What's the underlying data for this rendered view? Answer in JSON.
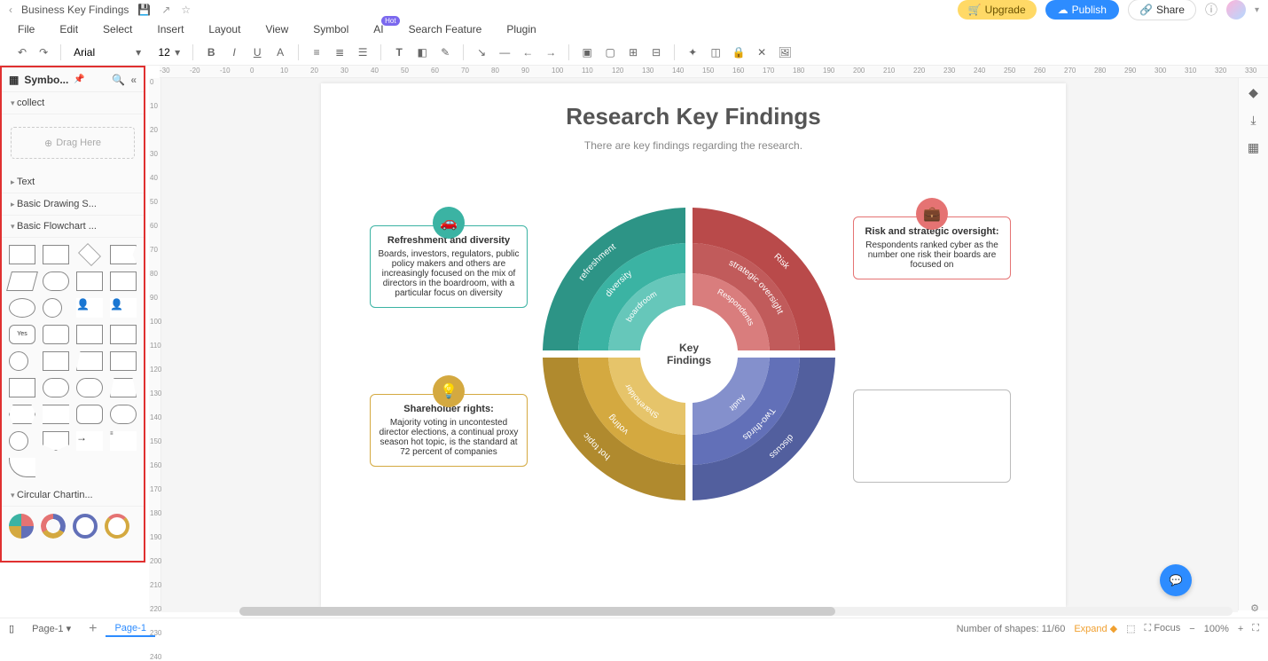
{
  "titlebar": {
    "doc_title": "Business Key Findings"
  },
  "buttons": {
    "upgrade": "Upgrade",
    "publish": "Publish",
    "share": "Share"
  },
  "menu": {
    "file": "File",
    "edit": "Edit",
    "select": "Select",
    "insert": "Insert",
    "layout": "Layout",
    "view": "View",
    "symbol": "Symbol",
    "ai": "AI",
    "search": "Search Feature",
    "plugin": "Plugin"
  },
  "toolbar": {
    "font": "Arial",
    "size": "12"
  },
  "sidebar": {
    "title": "Symbo...",
    "collect": "collect",
    "drag": "Drag Here",
    "text": "Text",
    "basic_drawing": "Basic Drawing S...",
    "basic_flowchart": "Basic Flowchart ...",
    "circular": "Circular Chartin..."
  },
  "canvas": {
    "title": "Research Key Findings",
    "subtitle": "There are key findings regarding the research.",
    "center": "Key Findings",
    "segments": {
      "q1": {
        "outer": "Risk",
        "mid": "strategic oversight",
        "inner": "Respondents"
      },
      "q2": {
        "outer": "discuss",
        "mid": "Two-thirds",
        "inner": "Audit"
      },
      "q3": {
        "outer": "hot topic",
        "mid": "voting",
        "inner": "Shareholder"
      },
      "q4": {
        "outer": "refreshment",
        "mid": "diversity",
        "inner": "boardroom"
      }
    },
    "callouts": {
      "teal": {
        "title": "Refreshment and diversity",
        "body": "Boards, investors, regulators, public policy makers and others are increasingly focused on the mix of directors in the boardroom, with a particular focus on diversity"
      },
      "red": {
        "title": "Risk and strategic oversight:",
        "body": "Respondents ranked cyber as the number one risk their boards are focused on"
      },
      "yellow": {
        "title": "Shareholder rights:",
        "body": "Majority voting in uncontested director elections, a continual proxy season hot topic, is the standard at 72 percent of companies"
      }
    }
  },
  "chart_data": {
    "type": "pie",
    "title": "Key Findings",
    "series": [
      {
        "name": "Risk / strategic oversight / Respondents",
        "values": [
          25
        ],
        "color": "#c15b5b"
      },
      {
        "name": "discuss / Two-thirds / Audit",
        "values": [
          25
        ],
        "color": "#6270b8"
      },
      {
        "name": "hot topic / voting / Shareholder",
        "values": [
          25
        ],
        "color": "#d4a940"
      },
      {
        "name": "refreshment / diversity / boardroom",
        "values": [
          25
        ],
        "color": "#3bb3a3"
      }
    ],
    "layers": 3
  },
  "footer": {
    "page_dropdown": "Page-1",
    "page_tab": "Page-1",
    "shapes": "Number of shapes: 11/60",
    "expand": "Expand",
    "focus": "Focus",
    "zoom": "100%"
  }
}
